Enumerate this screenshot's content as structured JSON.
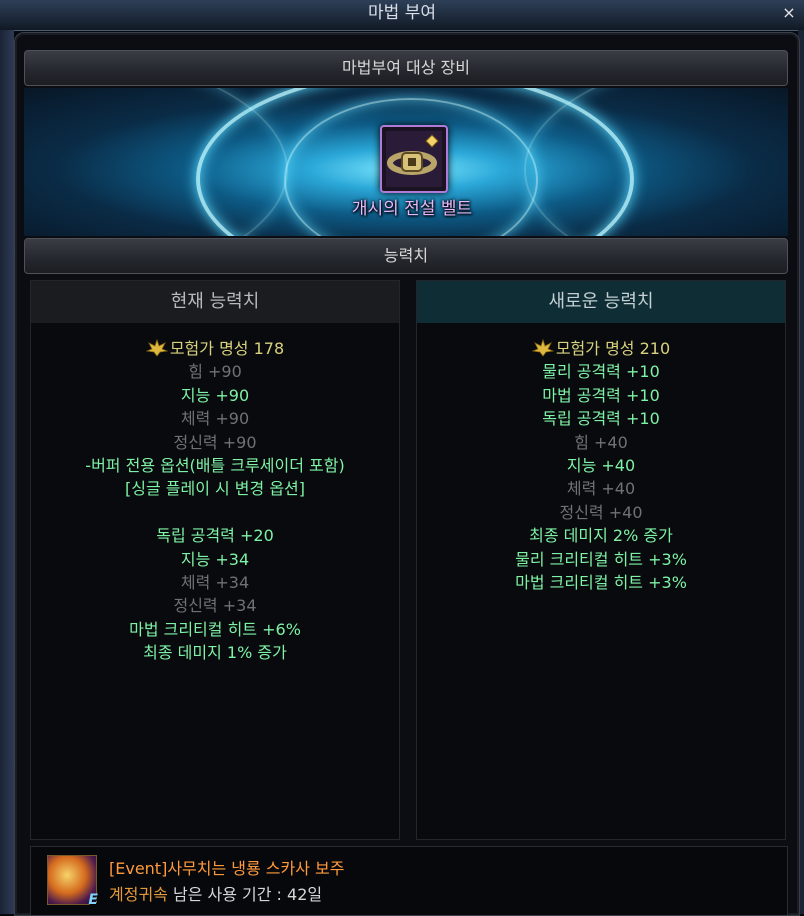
{
  "window": {
    "title": "마법 부여",
    "close": "×"
  },
  "target": {
    "header": "마법부여 대상 장비",
    "item_name": "개시의 전설 벨트",
    "item_icon": "belt-icon"
  },
  "stats_header": "능력치",
  "current": {
    "header": "현재 능력치",
    "fame_label": "모험가 명성",
    "fame_value": "178",
    "lines": [
      {
        "text": "힘 +90",
        "dim": true
      },
      {
        "text": "지능 +90",
        "dim": false
      },
      {
        "text": "체력 +90",
        "dim": true
      },
      {
        "text": "정신력 +90",
        "dim": true
      },
      {
        "text": "-버퍼 전용 옵션(배틀 크루세이더 포함)",
        "dim": false
      },
      {
        "text": "[싱글 플레이 시 변경 옵션]",
        "dim": false
      },
      {
        "text": "",
        "dim": false
      },
      {
        "text": "독립 공격력 +20",
        "dim": false
      },
      {
        "text": "지능 +34",
        "dim": false
      },
      {
        "text": "체력 +34",
        "dim": true
      },
      {
        "text": "정신력 +34",
        "dim": true
      },
      {
        "text": "마법 크리티컬 히트 +6%",
        "dim": false
      },
      {
        "text": "최종 데미지 1% 증가",
        "dim": false
      }
    ]
  },
  "new": {
    "header": "새로운 능력치",
    "fame_label": "모험가 명성",
    "fame_value": "210",
    "lines": [
      {
        "text": "물리 공격력 +10",
        "dim": false
      },
      {
        "text": "마법 공격력 +10",
        "dim": false
      },
      {
        "text": "독립 공격력 +10",
        "dim": false
      },
      {
        "text": "힘 +40",
        "dim": true
      },
      {
        "text": "지능 +40",
        "dim": false
      },
      {
        "text": "체력 +40",
        "dim": true
      },
      {
        "text": "정신력 +40",
        "dim": true
      },
      {
        "text": "최종 데미지 2% 증가",
        "dim": false
      },
      {
        "text": "물리 크리티컬 히트 +3%",
        "dim": false
      },
      {
        "text": "마법 크리티컬 히트 +3%",
        "dim": false
      }
    ]
  },
  "material": {
    "name": "[Event]사무치는 냉룡 스카사 보주",
    "bound": "계정귀속",
    "remaining": "남은 사용 기간 : 42일",
    "badge": "E",
    "icon": "orb-icon"
  },
  "colors": {
    "green": "#7ef2a6",
    "dim": "#6f7175",
    "fame": "#d8d27f",
    "item_name": "#e5b8ff",
    "event": "#ff9a3c"
  }
}
